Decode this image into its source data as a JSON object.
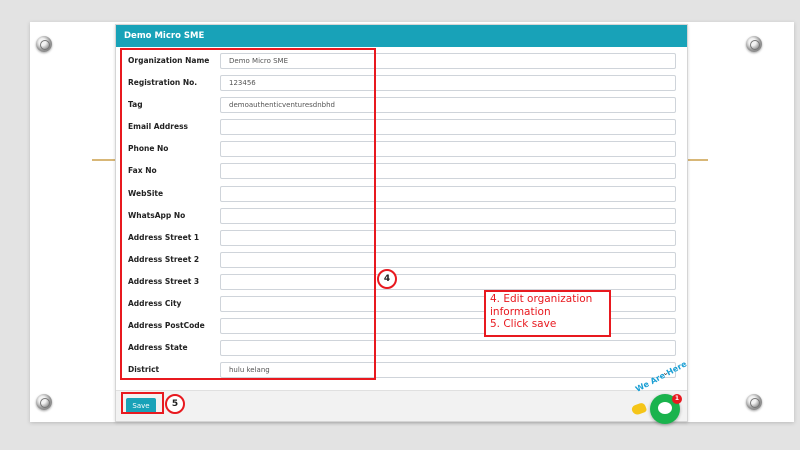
{
  "card": {
    "title": "Demo Micro SME"
  },
  "form": {
    "fields": [
      {
        "label": "Organization Name",
        "value": "Demo Micro SME"
      },
      {
        "label": "Registration No.",
        "value": "123456"
      },
      {
        "label": "Tag",
        "value": "demoauthenticventuresdnbhd"
      },
      {
        "label": "Email Address",
        "value": ""
      },
      {
        "label": "Phone No",
        "value": ""
      },
      {
        "label": "Fax No",
        "value": ""
      },
      {
        "label": "WebSite",
        "value": ""
      },
      {
        "label": "WhatsApp No",
        "value": ""
      },
      {
        "label": "Address Street 1",
        "value": ""
      },
      {
        "label": "Address Street 2",
        "value": ""
      },
      {
        "label": "Address Street 3",
        "value": ""
      },
      {
        "label": "Address City",
        "value": ""
      },
      {
        "label": "Address PostCode",
        "value": ""
      },
      {
        "label": "Address State",
        "value": ""
      },
      {
        "label": "District",
        "value": "hulu kelang"
      }
    ]
  },
  "footer": {
    "save_label": "Save"
  },
  "annotations": {
    "step4_number": "4",
    "step5_number": "5",
    "note_lines": [
      "4. Edit organization",
      "information",
      "5. Click save"
    ]
  },
  "chat_widget": {
    "text": "We Are Here",
    "badge": "1"
  },
  "colors": {
    "header": "#18a2b8",
    "annotation_red": "#e8191f",
    "chat_green": "#1ab34d"
  }
}
